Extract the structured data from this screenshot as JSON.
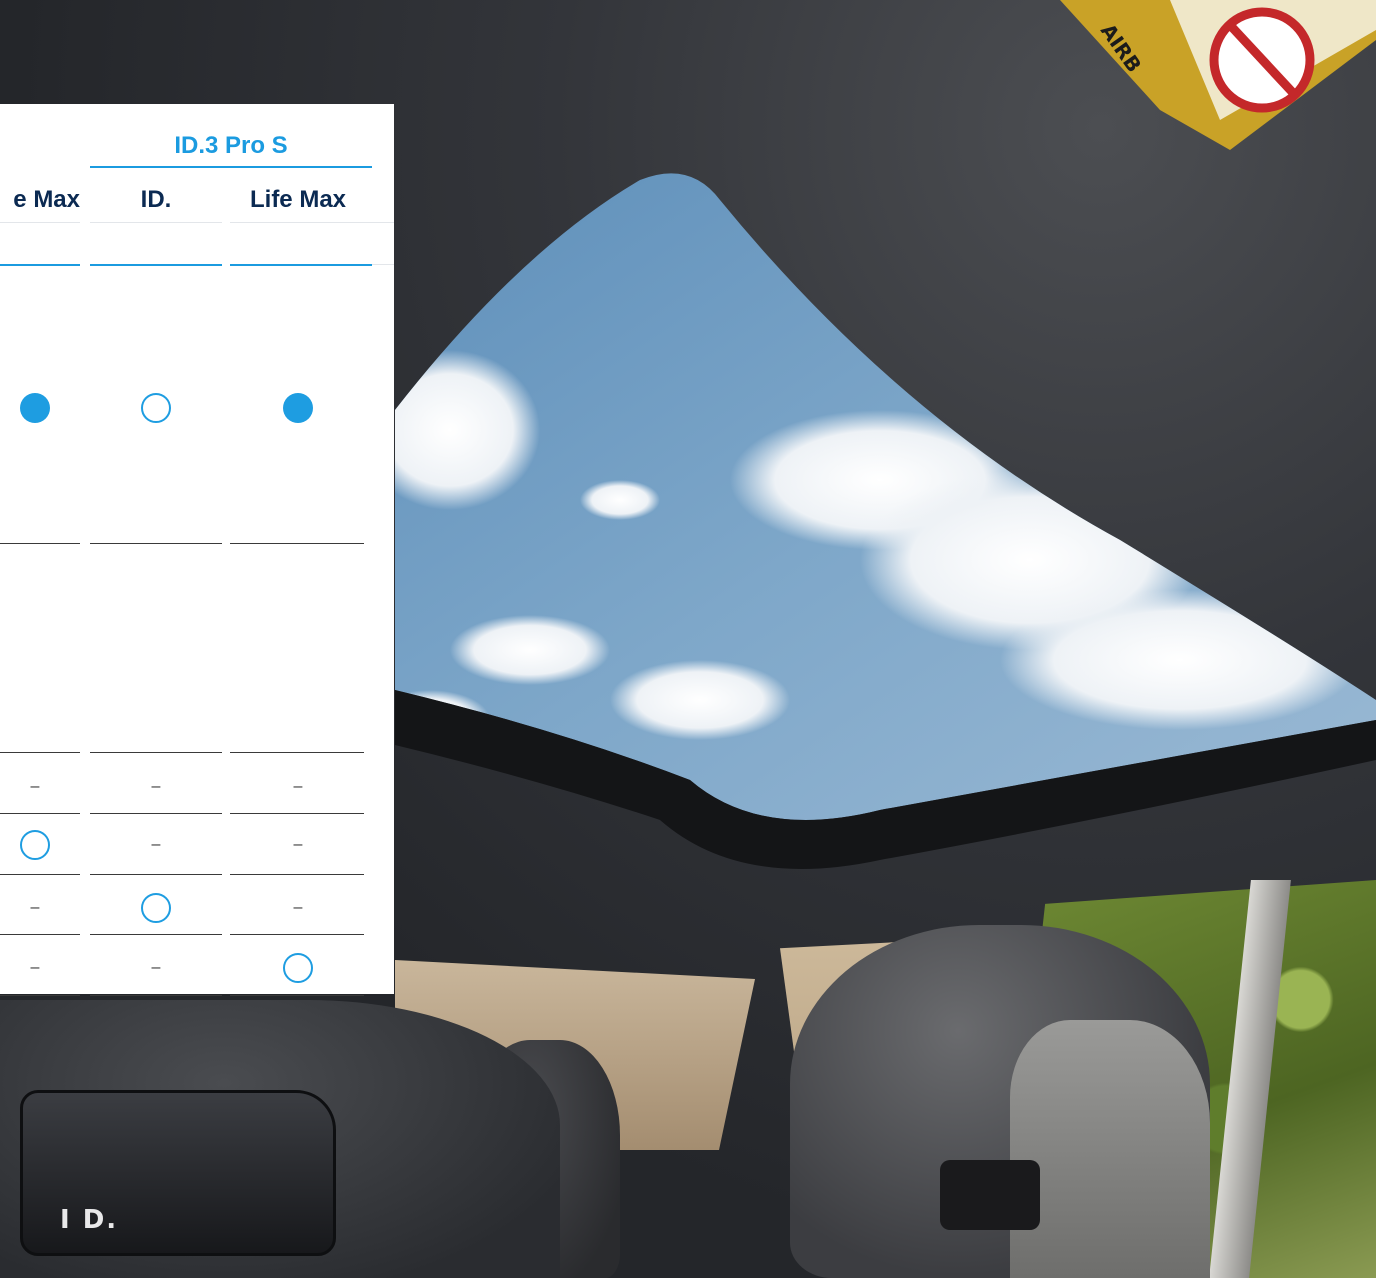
{
  "table": {
    "group_title": "ID.3 Pro S",
    "columns": [
      "e Max",
      "ID.",
      "Life Max"
    ],
    "rows": [
      {
        "values": [
          "filled",
          "open",
          "filled"
        ]
      },
      {
        "values": [
          "",
          "",
          ""
        ]
      },
      {
        "values": [
          "–",
          "–",
          "–"
        ]
      },
      {
        "values": [
          "open",
          "–",
          "–"
        ]
      },
      {
        "values": [
          "–",
          "open",
          "–"
        ]
      },
      {
        "values": [
          "–",
          "–",
          "open"
        ]
      }
    ]
  },
  "photo": {
    "seat_logo": "I D.",
    "sticker_text": "AIRB"
  },
  "colors": {
    "accent": "#1b9be0",
    "heading": "#0b2a52"
  }
}
